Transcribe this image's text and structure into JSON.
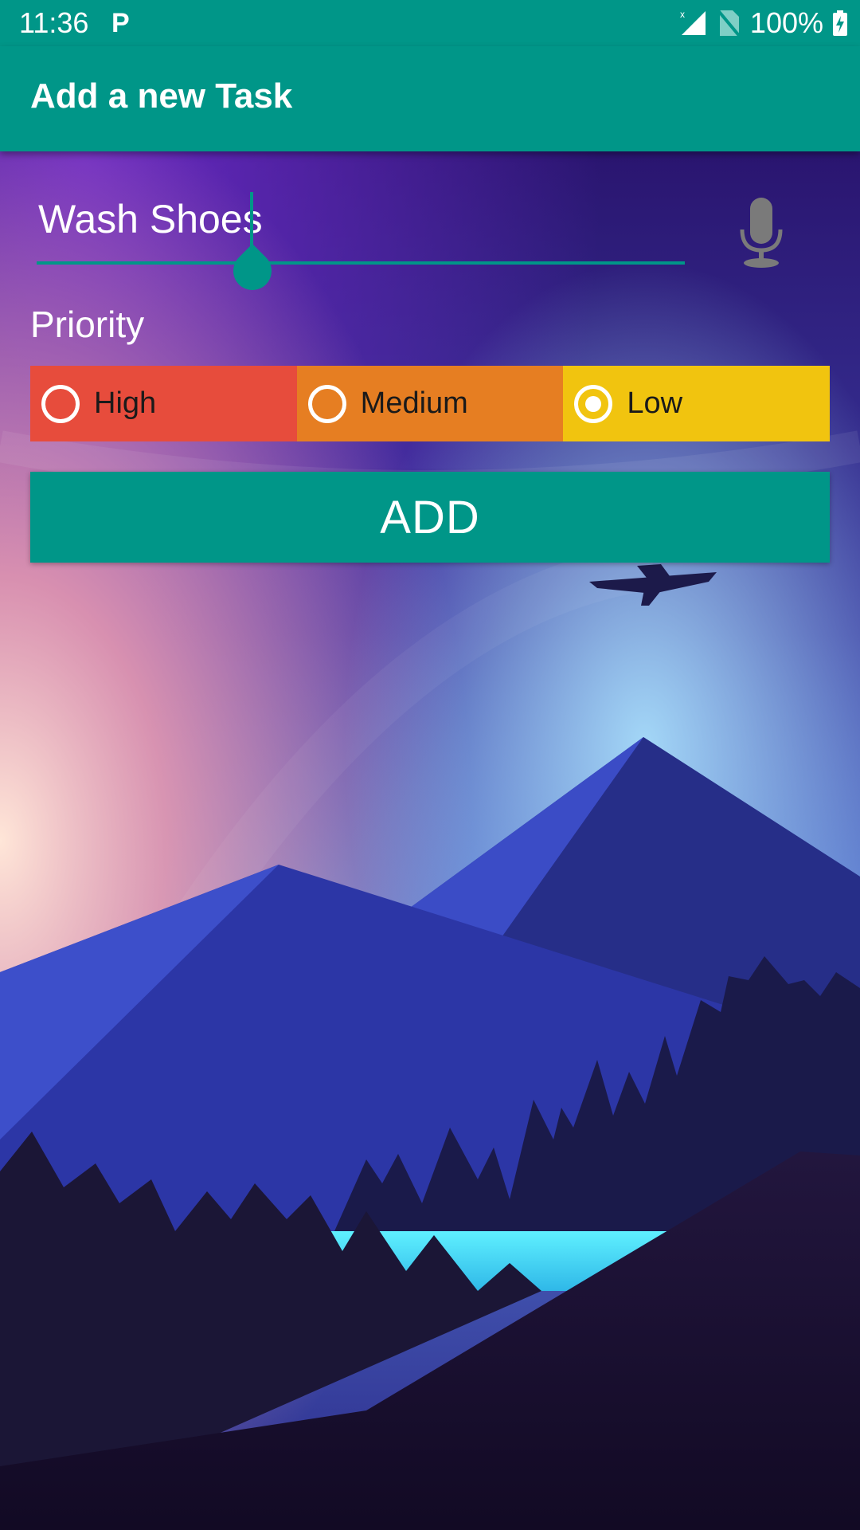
{
  "status_bar": {
    "time": "11:36",
    "notification_icon": "parking-p-icon",
    "battery": "100%"
  },
  "app_bar": {
    "title": "Add a new Task"
  },
  "form": {
    "task_value": "Wash Shoes",
    "mic_icon": "microphone-icon",
    "priority_label": "Priority",
    "priority_options": [
      {
        "label": "High",
        "color": "#E74C3C",
        "selected": false
      },
      {
        "label": "Medium",
        "color": "#E67E22",
        "selected": false
      },
      {
        "label": "Low",
        "color": "#F1C40F",
        "selected": true
      }
    ],
    "add_label": "ADD"
  },
  "colors": {
    "accent": "#009688"
  }
}
